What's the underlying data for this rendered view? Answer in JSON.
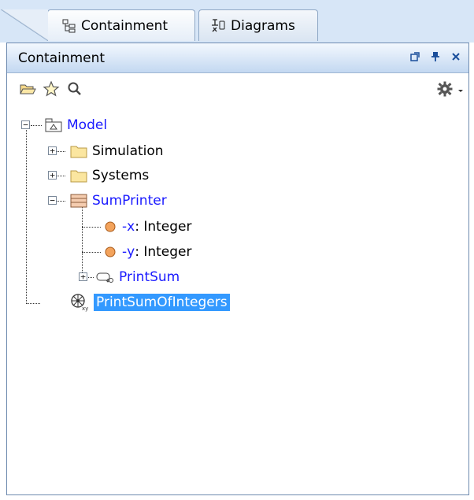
{
  "tabs": [
    {
      "label": "Containment",
      "icon": "containment-tree-icon",
      "active": true
    },
    {
      "label": "Diagrams",
      "icon": "diagrams-icon",
      "active": false
    }
  ],
  "panel": {
    "title": "Containment",
    "controls": [
      "undock-icon",
      "pin-icon",
      "close-icon"
    ],
    "toolbar": [
      "open-folder-icon",
      "star-icon",
      "search-icon",
      "gear-icon",
      "dropdown-icon"
    ]
  },
  "tree": {
    "root": {
      "label": "Model",
      "icon": "package-icon"
    },
    "items": [
      {
        "label": "Simulation",
        "icon": "folder-icon"
      },
      {
        "label": "Systems",
        "icon": "folder-icon"
      },
      {
        "label": "SumPrinter",
        "icon": "block-icon"
      },
      {
        "visibility": "-",
        "name": "x",
        "type": " : Integer",
        "icon": "property-icon"
      },
      {
        "visibility": "-",
        "name": "y",
        "type": " : Integer",
        "icon": "property-icon"
      },
      {
        "label": "PrintSum",
        "icon": "activity-icon"
      },
      {
        "label": "PrintSumOfIntegers",
        "icon": "simulation-config-icon",
        "selected": true
      }
    ]
  },
  "colors": {
    "header_bg": "#d7e6f7",
    "panel_border": "#6d8aaf",
    "link_blue": "#1a1aff",
    "selection": "#3399ff"
  }
}
